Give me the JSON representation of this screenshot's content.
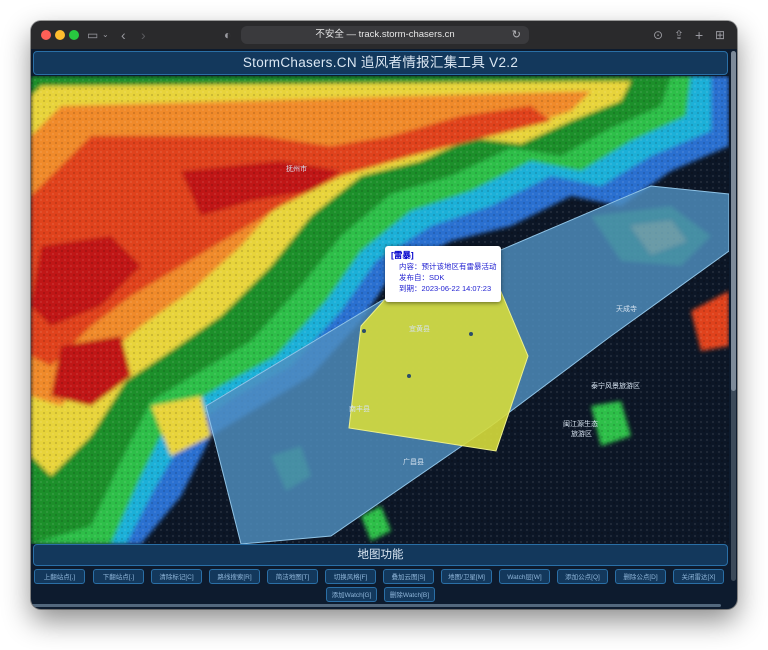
{
  "browser": {
    "url_text": "不安全 — track.storm-chasers.cn",
    "icons": [
      "sidebar-icon",
      "chevron-down-icon",
      "back-icon",
      "forward-icon",
      "privacy-shield-icon",
      "reload-icon",
      "download-icon",
      "share-icon",
      "new-tab-icon",
      "tab-overview-icon"
    ]
  },
  "app": {
    "title": "StormChasers.CN 追风者情报汇集工具 V2.2"
  },
  "map": {
    "labels": {
      "fuzhou": "抚州市",
      "yihuang": "宜黄县",
      "nanfeng": "南丰县",
      "guangchang": "广昌县",
      "tiancheng": "天成寺",
      "taining": "泰宁风景旅游区",
      "minjiang": "闽江源生态",
      "minjiang2": "旅游区"
    },
    "colors": {
      "warning_polygon": "#4f8fbf",
      "storm_polygon": "#d6dc3c"
    },
    "popup": {
      "title": "[雷暴]",
      "content": "内容：预计该地区有雷暴活动",
      "publisher": "发布自：SDK",
      "expires": "到期：2023-06-22 14:07:23"
    }
  },
  "functions": {
    "title": "地图功能",
    "buttons": [
      "上翻站点[,]",
      "下翻站点[.]",
      "清除标记[C]",
      "路线搜索[R]",
      "简洁地图[T]",
      "切换风格[F]",
      "叠加云图[S]",
      "地图/卫星[M]",
      "Watch层[W]",
      "添加公点[Q]",
      "删除公点[D]",
      "关闭雷达[X]",
      "添加Watch[G]",
      "删除Watch[B]"
    ]
  }
}
